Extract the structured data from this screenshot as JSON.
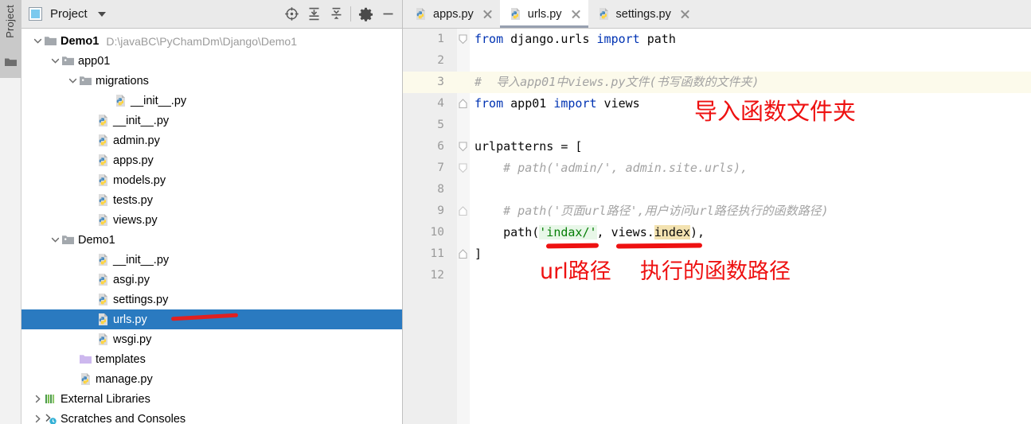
{
  "tool_strip": {
    "label": "Project",
    "folder_icon": "folder-icon"
  },
  "project_panel": {
    "header": {
      "icon": "project-view-icon",
      "title": "Project",
      "dropdown_icon": "chevron-down-icon",
      "buttons": [
        {
          "name": "scroll-from-source-icon",
          "tooltip": "Select Opened File"
        },
        {
          "name": "expand-all-icon",
          "tooltip": "Expand All"
        },
        {
          "name": "collapse-all-icon",
          "tooltip": "Collapse All"
        },
        {
          "name": "gear-icon",
          "tooltip": "Settings"
        },
        {
          "name": "minimize-icon",
          "tooltip": "Hide"
        }
      ]
    },
    "tree": [
      {
        "label": "Demo1",
        "path": "D:\\javaBC\\PyChamDm\\Django\\Demo1",
        "icon": "folder-icon",
        "indent": 0,
        "arrow": "expanded",
        "bold": true,
        "selected": false
      },
      {
        "label": "app01",
        "path": "",
        "icon": "module-folder-icon",
        "indent": 1,
        "arrow": "expanded",
        "bold": false,
        "selected": false
      },
      {
        "label": "migrations",
        "path": "",
        "icon": "module-folder-icon",
        "indent": 2,
        "arrow": "expanded",
        "bold": false,
        "selected": false
      },
      {
        "label": "__init__.py",
        "path": "",
        "icon": "python-file-icon",
        "indent": 4,
        "arrow": "none",
        "bold": false,
        "selected": false
      },
      {
        "label": "__init__.py",
        "path": "",
        "icon": "python-file-icon",
        "indent": 3,
        "arrow": "none",
        "bold": false,
        "selected": false
      },
      {
        "label": "admin.py",
        "path": "",
        "icon": "python-file-icon",
        "indent": 3,
        "arrow": "none",
        "bold": false,
        "selected": false
      },
      {
        "label": "apps.py",
        "path": "",
        "icon": "python-file-icon",
        "indent": 3,
        "arrow": "none",
        "bold": false,
        "selected": false
      },
      {
        "label": "models.py",
        "path": "",
        "icon": "python-file-icon",
        "indent": 3,
        "arrow": "none",
        "bold": false,
        "selected": false
      },
      {
        "label": "tests.py",
        "path": "",
        "icon": "python-file-icon",
        "indent": 3,
        "arrow": "none",
        "bold": false,
        "selected": false
      },
      {
        "label": "views.py",
        "path": "",
        "icon": "python-file-icon",
        "indent": 3,
        "arrow": "none",
        "bold": false,
        "selected": false
      },
      {
        "label": "Demo1",
        "path": "",
        "icon": "module-folder-icon",
        "indent": 1,
        "arrow": "expanded",
        "bold": false,
        "selected": false
      },
      {
        "label": "__init__.py",
        "path": "",
        "icon": "python-file-icon",
        "indent": 3,
        "arrow": "none",
        "bold": false,
        "selected": false
      },
      {
        "label": "asgi.py",
        "path": "",
        "icon": "python-file-icon",
        "indent": 3,
        "arrow": "none",
        "bold": false,
        "selected": false
      },
      {
        "label": "settings.py",
        "path": "",
        "icon": "python-file-icon",
        "indent": 3,
        "arrow": "none",
        "bold": false,
        "selected": false
      },
      {
        "label": "urls.py",
        "path": "",
        "icon": "python-file-icon",
        "indent": 3,
        "arrow": "none",
        "bold": false,
        "selected": true
      },
      {
        "label": "wsgi.py",
        "path": "",
        "icon": "python-file-icon",
        "indent": 3,
        "arrow": "none",
        "bold": false,
        "selected": false
      },
      {
        "label": "templates",
        "path": "",
        "icon": "templates-folder-icon",
        "indent": 2,
        "arrow": "none",
        "bold": false,
        "selected": false
      },
      {
        "label": "manage.py",
        "path": "",
        "icon": "python-file-icon",
        "indent": 2,
        "arrow": "none",
        "bold": false,
        "selected": false
      },
      {
        "label": "External Libraries",
        "path": "",
        "icon": "libraries-icon",
        "indent": 0,
        "arrow": "collapsed",
        "bold": false,
        "selected": false
      },
      {
        "label": "Scratches and Consoles",
        "path": "",
        "icon": "scratches-icon",
        "indent": 0,
        "arrow": "collapsed",
        "bold": false,
        "selected": false
      }
    ],
    "selected_row_marker_color": "#e02020"
  },
  "editor": {
    "tabs": [
      {
        "label": "apps.py",
        "icon": "python-file-icon",
        "active": false,
        "close_icon": "close-icon"
      },
      {
        "label": "urls.py",
        "icon": "python-file-icon",
        "active": true,
        "close_icon": "close-icon"
      },
      {
        "label": "settings.py",
        "icon": "python-file-icon",
        "active": false,
        "close_icon": "close-icon"
      }
    ],
    "line_numbers": [
      "1",
      "2",
      "3",
      "4",
      "5",
      "6",
      "7",
      "8",
      "9",
      "10",
      "11",
      "12"
    ],
    "highlighted_line": 3,
    "code_lines": [
      {
        "n": 1,
        "fold": "open",
        "segments": [
          {
            "t": "from",
            "c": "kw"
          },
          {
            "t": " django.urls ",
            "c": ""
          },
          {
            "t": "import",
            "c": "kw"
          },
          {
            "t": " path",
            "c": ""
          }
        ]
      },
      {
        "n": 2,
        "fold": "none",
        "segments": []
      },
      {
        "n": 3,
        "fold": "none",
        "segments": [
          {
            "t": "#  导入app01中views.py文件(书写函数的文件夹)",
            "c": "cmt"
          }
        ]
      },
      {
        "n": 4,
        "fold": "end",
        "segments": [
          {
            "t": "from",
            "c": "kw"
          },
          {
            "t": " app01 ",
            "c": ""
          },
          {
            "t": "import",
            "c": "kw"
          },
          {
            "t": " views",
            "c": ""
          }
        ]
      },
      {
        "n": 5,
        "fold": "none",
        "segments": []
      },
      {
        "n": 6,
        "fold": "open",
        "segments": [
          {
            "t": "urlpatterns = [",
            "c": ""
          }
        ]
      },
      {
        "n": 7,
        "fold": "open-ind",
        "segments": [
          {
            "t": "    # path('admin/', admin.site.urls),",
            "c": "cmt"
          }
        ]
      },
      {
        "n": 8,
        "fold": "none",
        "segments": []
      },
      {
        "n": 9,
        "fold": "end-ind",
        "segments": [
          {
            "t": "    # path('页面url路径',用户访问url路径执行的函数路径)",
            "c": "cmt"
          }
        ]
      },
      {
        "n": 10,
        "fold": "none",
        "segments": [
          {
            "t": "    path(",
            "c": ""
          },
          {
            "t": "'indax/'",
            "c": "str hl-green"
          },
          {
            "t": ", ",
            "c": ""
          },
          {
            "t": "views.",
            "c": ""
          },
          {
            "t": "index",
            "c": "hl-tan"
          },
          {
            "t": "),",
            "c": ""
          }
        ]
      },
      {
        "n": 11,
        "fold": "end",
        "segments": [
          {
            "t": "]",
            "c": ""
          }
        ]
      },
      {
        "n": 12,
        "fold": "none",
        "segments": []
      }
    ],
    "annotations": [
      {
        "name": "import-views-annotation",
        "text": "导入函数文件夹"
      },
      {
        "name": "url-path-annotation",
        "text": "url路径"
      },
      {
        "name": "view-function-annotation",
        "text": "执行的函数路径"
      }
    ],
    "ink_color": "#ee1111"
  }
}
